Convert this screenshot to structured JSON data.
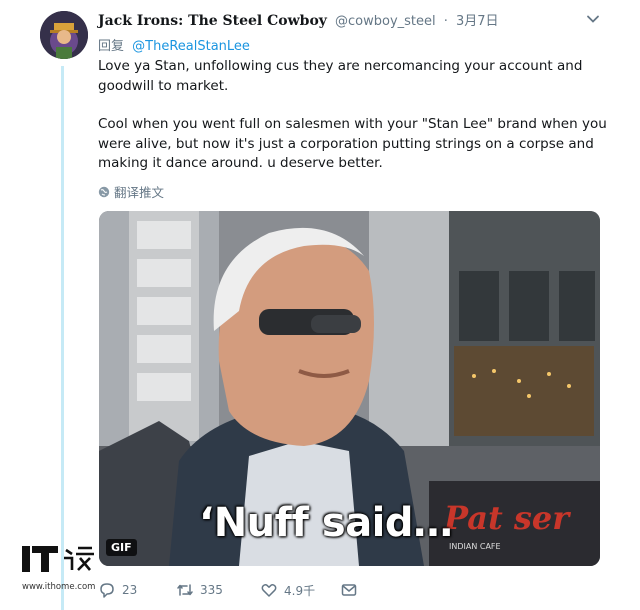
{
  "tweet": {
    "display_name": "Jack Irons: The Steel Cowboy",
    "handle": "@cowboy_steel",
    "separator": "·",
    "date": "3月7日",
    "reply_prefix": "回复",
    "reply_to": "@TheRealStanLee",
    "paragraphs": [
      "Love ya Stan, unfollowing cus they are nercomancing your account and goodwill to market.",
      "Cool when you went full on salesmen with your \"Stan Lee\" brand when you were alive, but now it's just a corporation putting strings on a corpse and making it dance around. u deserve better."
    ],
    "translate_label": "翻译推文",
    "media": {
      "badge": "GIF",
      "caption": "‘Nuff said…",
      "sign_text": "Pat   ser",
      "sign_subtext": "INDIAN CAFE"
    },
    "actions": {
      "replies": "23",
      "retweets": "335",
      "likes": "4.9千"
    }
  },
  "watermark": {
    "logo": "IT之家",
    "url": "www.ithome.com"
  },
  "colors": {
    "accent": "#1b95e0",
    "thread_line": "#c6eaf6",
    "muted": "#657786"
  }
}
